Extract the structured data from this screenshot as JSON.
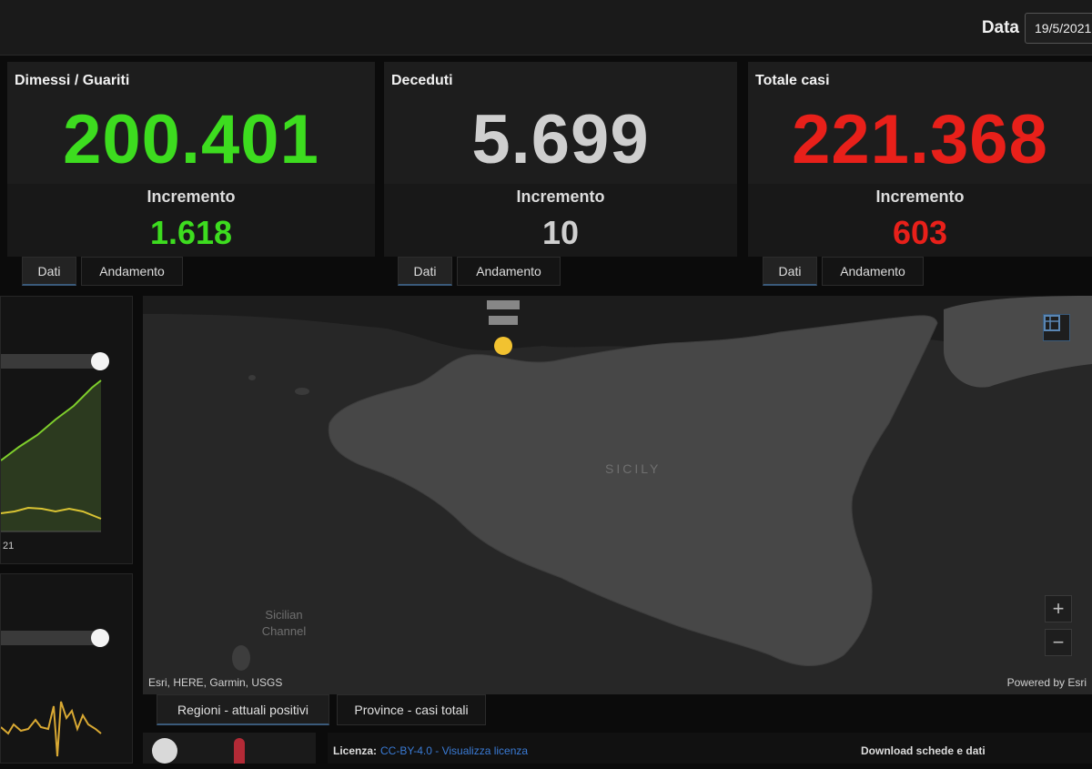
{
  "header": {
    "date_label": "Data",
    "date_value": "19/5/2021"
  },
  "cards": [
    {
      "title": "Dimessi / Guariti",
      "value": "200.401",
      "inc_label": "Incremento",
      "inc_value": "1.618",
      "color": "#3ddc1f"
    },
    {
      "title": "Deceduti",
      "value": "5.699",
      "inc_label": "Incremento",
      "inc_value": "10",
      "color": "#cfcfcf"
    },
    {
      "title": "Totale casi",
      "value": "221.368",
      "inc_label": "Incremento",
      "inc_value": "603",
      "color": "#e8201a"
    }
  ],
  "card_tabs": {
    "data_label": "Dati",
    "trend_label": "Andamento"
  },
  "left_panel": {
    "date_fragment": "21"
  },
  "map": {
    "region_label": "SICILY",
    "sea_label": "Sicilian Channel",
    "attribution": "Esri, HERE, Garmin, USGS",
    "powered_by": "Powered by Esri",
    "zoom_in": "+",
    "zoom_out": "−"
  },
  "bottom_tabs": [
    "Regioni - attuali positivi",
    "Province - casi totali"
  ],
  "footer": {
    "license_label": "Licenza:",
    "license_value": "CC-BY-4.0 - Visualizza licenza",
    "download_label": "Download schede e dati"
  },
  "colors": {
    "accent_blue": "#3a7bd5",
    "marker": "#f2c230"
  }
}
